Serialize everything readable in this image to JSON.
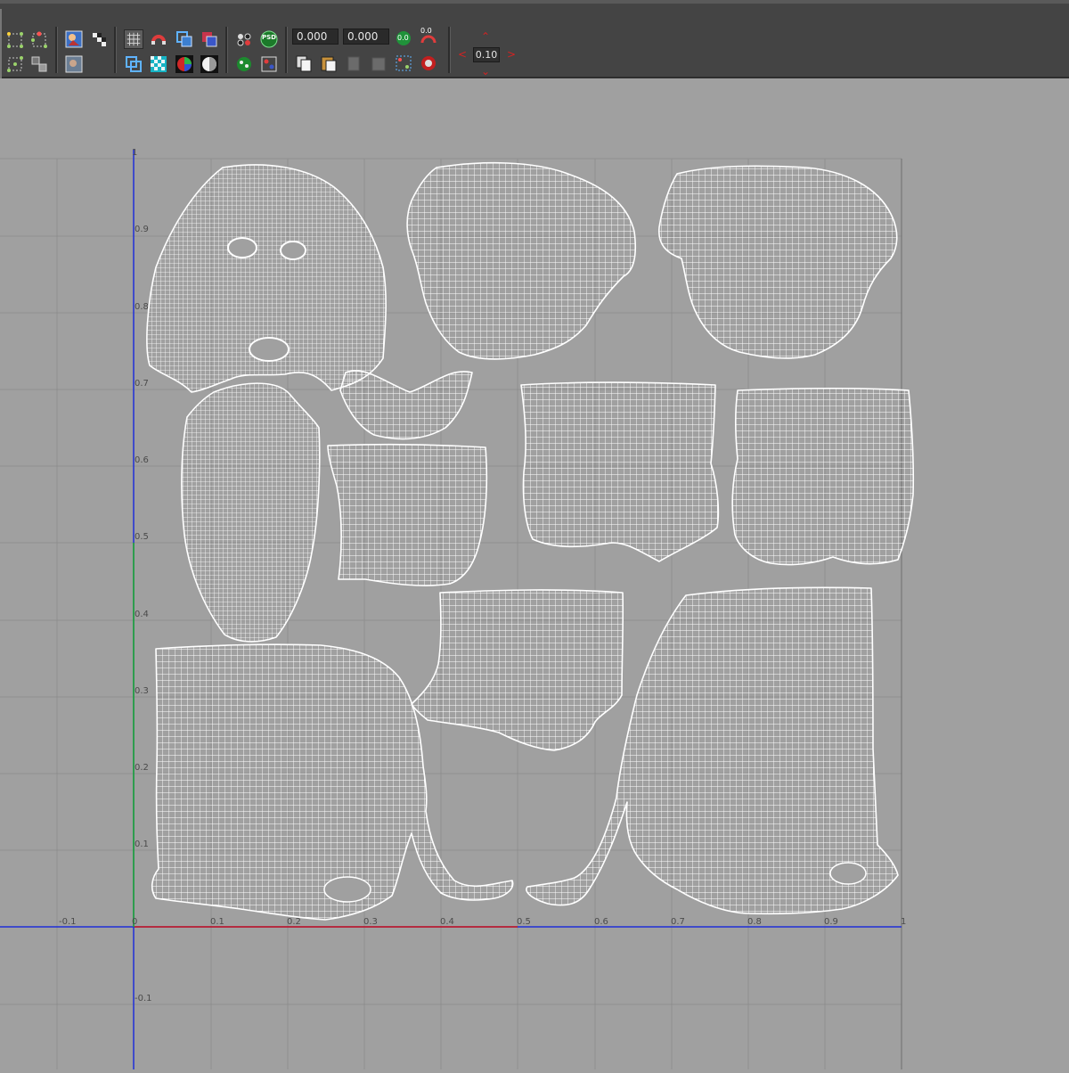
{
  "toolbar": {
    "u_field_value": "0.000",
    "v_field_value": "0.000",
    "step_value": "0.10",
    "badge_psd": "PSD",
    "badge_zero": "0.0",
    "badge_zero_small": "0.0",
    "icons": [
      "select-vertex-icon",
      "select-edge-icon",
      "select-face-icon",
      "select-uv-icon",
      "image-display-icon",
      "checker-display-icon",
      "image-dim-icon",
      "grid-toggle-icon",
      "snap-magnet-icon",
      "copy-shell-icon",
      "overlap-shell-icon",
      "shaded-uv-icon",
      "checker-map-icon",
      "rgb-channels-icon",
      "alpha-channel-icon",
      "uv-snapshot-icon",
      "psd-network-icon",
      "texture-border-icon",
      "distortion-icon",
      "copy-uvs-icon",
      "paste-uvs-icon",
      "paste-u-icon",
      "paste-v-icon",
      "cycle-uvs-icon",
      "delete-uvs-icon",
      "move-u-icon",
      "move-v-icon"
    ]
  },
  "uv_editor": {
    "grid_color": "#8f8f8f",
    "background_color": "#a0a0a0",
    "u_axis_color": "#d01818",
    "v_axis_color": "#1fae2a",
    "axis_blue_color": "#1f2fd8",
    "wire_color": "#ffffff",
    "u_tick_labels": [
      "-0.1",
      "0",
      "0.1",
      "0.2",
      "0.3",
      "0.4",
      "0.5",
      "0.6",
      "0.7",
      "0.8",
      "0.9",
      "1"
    ],
    "v_tick_labels": [
      "1",
      "0.9",
      "0.8",
      "0.7",
      "0.6",
      "0.5",
      "0.4",
      "0.3",
      "0.2",
      "0.1",
      "-0.1"
    ]
  }
}
